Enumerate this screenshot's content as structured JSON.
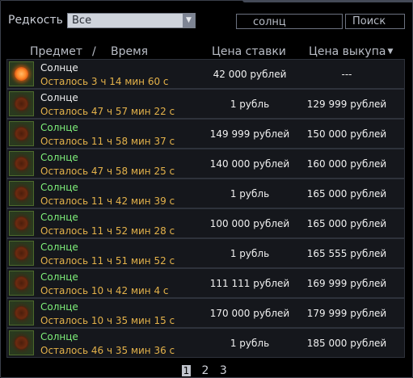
{
  "filters": {
    "rarity_label": "Редкость",
    "rarity_value": "Все",
    "search_value": "солнц",
    "search_button": "Поиск"
  },
  "columns": {
    "item": "Предмет",
    "separator": "/",
    "time": "Время",
    "bid": "Цена ставки",
    "buyout": "Цена выкупа",
    "sort_indicator": "▼"
  },
  "rows": [
    {
      "name": "Солнце",
      "time": "Осталось 3 ч 14 мин 60 с",
      "bid": "42 000 рублей",
      "buyout": "---"
    },
    {
      "name": "Солнце",
      "time": "Осталось 47 ч 57 мин 22 с",
      "bid": "1 рубль",
      "buyout": "129 999 рублей"
    },
    {
      "name": "Солнце",
      "time": "Осталось 11 ч 58 мин 37 с",
      "bid": "149 999 рублей",
      "buyout": "150 000 рублей"
    },
    {
      "name": "Солнце",
      "time": "Осталось 47 ч 58 мин 25 с",
      "bid": "140 000 рублей",
      "buyout": "160 000 рублей"
    },
    {
      "name": "Солнце",
      "time": "Осталось 11 ч 42 мин 39 с",
      "bid": "1 рубль",
      "buyout": "165 000 рублей"
    },
    {
      "name": "Солнце",
      "time": "Осталось 11 ч 52 мин 28 с",
      "bid": "100 000 рублей",
      "buyout": "165 000 рублей"
    },
    {
      "name": "Солнце",
      "time": "Осталось 11 ч 51 мин 52 с",
      "bid": "1 рубль",
      "buyout": "165 555 рублей"
    },
    {
      "name": "Солнце",
      "time": "Осталось 10 ч 42 мин 4 с",
      "bid": "111 111 рублей",
      "buyout": "169 999 рублей"
    },
    {
      "name": "Солнце",
      "time": "Осталось 10 ч 35 мин 15 с",
      "bid": "170 000 рублей",
      "buyout": "179 999 рублей"
    },
    {
      "name": "Солнце",
      "time": "Осталось 46 ч 35 мин 36 с",
      "bid": "1 рубль",
      "buyout": "185 000 рублей"
    }
  ],
  "pagination": {
    "pages": [
      "1",
      "2",
      "3"
    ],
    "current": "1"
  }
}
